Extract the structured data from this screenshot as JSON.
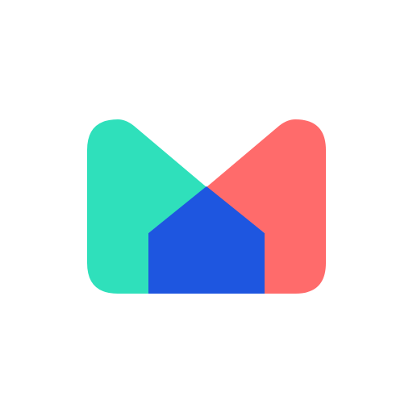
{
  "icon": {
    "name": "envelope-house-logo-icon",
    "colors": {
      "background": "#ffffff",
      "left_panel": "#2FE0BB",
      "right_panel": "#FF6B6B",
      "house": "#1E56E0"
    }
  }
}
